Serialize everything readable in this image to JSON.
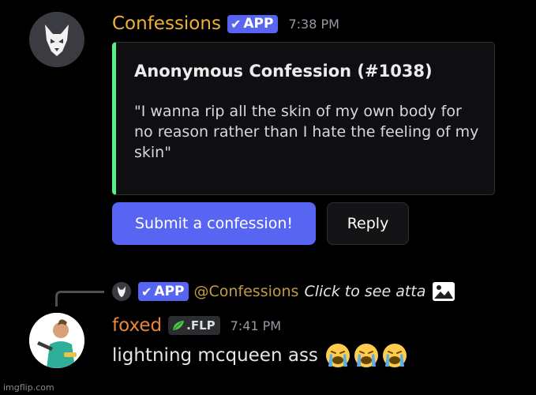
{
  "bot_message": {
    "author": "Confessions",
    "badge": "APP",
    "timestamp": "7:38 PM",
    "embed": {
      "title": "Anonymous Confession (#1038)",
      "body": "\"I wanna rip all the skin of my own body for no reason rather than I hate the feeling of my skin\"",
      "accent_color": "#57f287"
    },
    "buttons": {
      "submit_label": "Submit a confession!",
      "reply_label": "Reply"
    }
  },
  "reply_preview": {
    "badge": "APP",
    "mention": "@Confessions",
    "text": "Click to see atta",
    "attachment_icon": "image-icon"
  },
  "user_message": {
    "author": "foxed",
    "tag": ".FLP",
    "timestamp": "7:41 PM",
    "text": "lightning mcqueen ass",
    "emoji_icon": "loudly-crying-face-icon",
    "emoji_count": 3
  },
  "watermark": "imgflip.com",
  "colors": {
    "background": "#000000",
    "bot_name": "#f0b232",
    "user_name": "#e8873c",
    "app_badge": "#5865f2",
    "primary_button": "#5865f2"
  }
}
